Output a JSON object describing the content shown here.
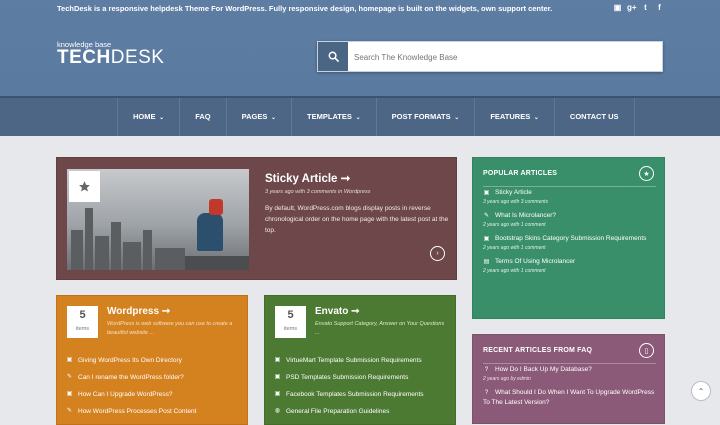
{
  "topbar": {
    "tagline": "TechDesk is a responsive helpdesk Theme For WordPress. Fully responsive design, homepage is built on the widgets, own support center.",
    "social_icons": [
      "apple-icon",
      "blogger-icon",
      "google-plus-icon",
      "twitter-icon",
      "facebook-icon"
    ]
  },
  "brand": {
    "subtitle": "knowledge base",
    "logo_bold": "TECH",
    "logo_light": "DESK"
  },
  "search": {
    "placeholder": "Search The Knowledge Base"
  },
  "nav": {
    "items": [
      {
        "label": "HOME",
        "dropdown": true
      },
      {
        "label": "FAQ",
        "dropdown": false
      },
      {
        "label": "PAGES",
        "dropdown": true
      },
      {
        "label": "TEMPLATES",
        "dropdown": true
      },
      {
        "label": "POST FORMATS",
        "dropdown": true
      },
      {
        "label": "FEATURES",
        "dropdown": true
      },
      {
        "label": "CONTACT US",
        "dropdown": false
      }
    ]
  },
  "sticky": {
    "title": "Sticky Article ➞",
    "meta": "3 years ago with 3 comments in Wordpress",
    "body": "By default, WordPress.com blogs display posts in reverse chronological order on the home page with the latest post at the top."
  },
  "popular": {
    "heading": "POPULAR ARTICLES",
    "items": [
      {
        "icon": "image-icon",
        "title": "Sticky Article",
        "meta": "3 years ago with 3 comments"
      },
      {
        "icon": "pencil-icon",
        "title": "What Is Microlancer?",
        "meta": "2 years ago with 1 comment"
      },
      {
        "icon": "image-icon",
        "title": "Bootstrap Skins Category Submission Requirements",
        "meta": "2 years ago with 1 comment"
      },
      {
        "icon": "film-icon",
        "title": "Terms Of Using Microlancer",
        "meta": "2 years ago with 1 comment"
      }
    ]
  },
  "faq": {
    "heading": "RECENT ARTICLES FROM FAQ",
    "items": [
      {
        "icon": "question-icon",
        "title": "How Do I Back Up My Database?",
        "meta": "2 years ago by edmin"
      },
      {
        "icon": "question-icon",
        "title": "What Should I Do When I Want To Upgrade WordPress To The Latest Version?",
        "meta": ""
      }
    ]
  },
  "categories": [
    {
      "count": "5",
      "count_label": "items",
      "title": "Wordpress ➞",
      "description": "WordPress is web software you can use to create a beautiful website ...",
      "items": [
        {
          "icon": "image-icon",
          "label": "Giving WordPress Its Own Directory"
        },
        {
          "icon": "pencil-icon",
          "label": "Can I rename the WordPress folder?"
        },
        {
          "icon": "image-icon",
          "label": "How Can I Upgrade WordPress?"
        },
        {
          "icon": "pencil-icon",
          "label": "How WordPress Processes Post Content"
        }
      ]
    },
    {
      "count": "5",
      "count_label": "items",
      "title": "Envato ➞",
      "description": "Envato Support Category, Answer on Your Questions ...",
      "items": [
        {
          "icon": "image-icon",
          "label": "VirtueMart Template Submission Requirements"
        },
        {
          "icon": "image-icon",
          "label": "PSD Templates Submission Requirements"
        },
        {
          "icon": "image-icon",
          "label": "Facebook Templates Submission Requirements"
        },
        {
          "icon": "globe-icon",
          "label": "General File Preparation Guidelines"
        }
      ]
    }
  ]
}
